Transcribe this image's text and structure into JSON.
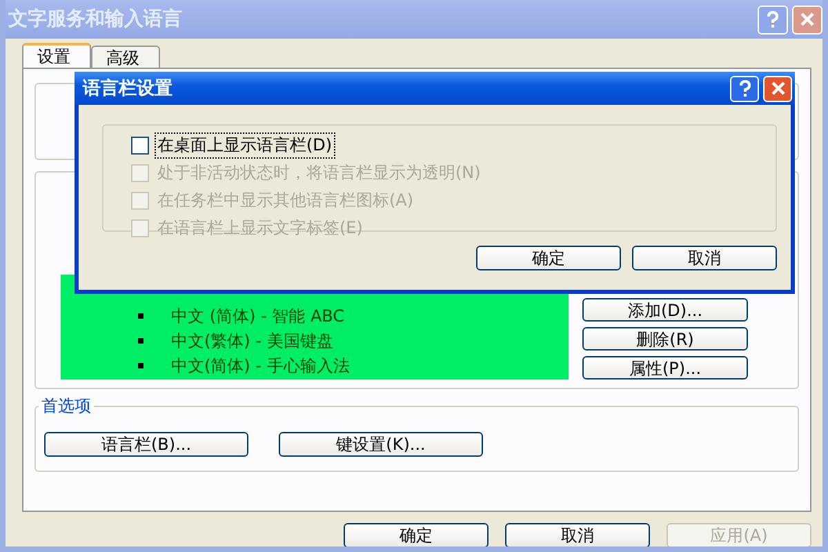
{
  "window": {
    "title": "文字服务和输入语言"
  },
  "tabs": [
    {
      "label": "设置",
      "selected": true
    },
    {
      "label": "高级",
      "selected": false
    }
  ],
  "services": [
    {
      "label": "中文 (简体) - 智能 ABC",
      "selected": false
    },
    {
      "label": "中文(繁体) - 美国键盘",
      "selected": false
    },
    {
      "label": "中文(简体) - 手心输入法",
      "selected": false
    }
  ],
  "service_buttons": [
    "添加(D)...",
    "删除(R)",
    "属性(P)..."
  ],
  "preferences": {
    "title": "首选项",
    "buttons": [
      "语言栏(B)...",
      "键设置(K)..."
    ]
  },
  "footer_buttons": [
    {
      "label": "确定",
      "disabled": false
    },
    {
      "label": "取消",
      "disabled": false
    },
    {
      "label": "应用(A)",
      "disabled": true
    }
  ],
  "dialog": {
    "title": "语言栏设置",
    "options": [
      {
        "label": "在桌面上显示语言栏(D)",
        "checked": false,
        "disabled": false,
        "focused": true
      },
      {
        "label": "处于非活动状态时，将语言栏显示为透明(N)",
        "checked": false,
        "disabled": true,
        "focused": false
      },
      {
        "label": "在任务栏中显示其他语言栏图标(A)",
        "checked": false,
        "disabled": true,
        "focused": false
      },
      {
        "label": "在语言栏上显示文字标签(E)",
        "checked": false,
        "disabled": true,
        "focused": false
      }
    ],
    "buttons": [
      "确定",
      "取消"
    ]
  }
}
